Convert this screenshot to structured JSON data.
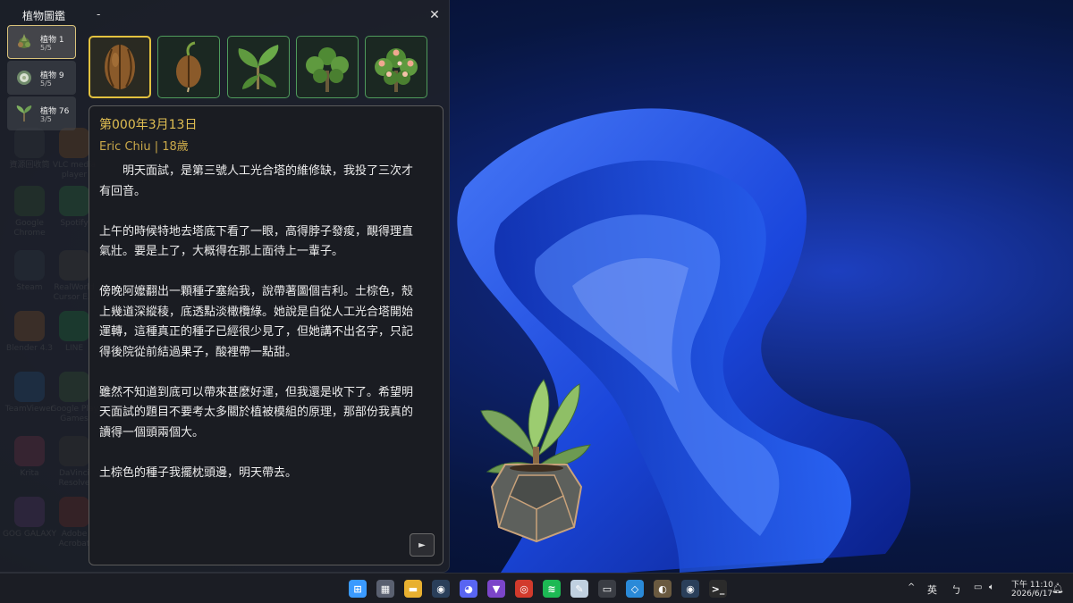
{
  "window": {
    "app_title": "植物圖鑑",
    "sub_title": "-",
    "close_icon": "close-icon"
  },
  "plants": [
    {
      "name": "植物 1",
      "count": "5/5",
      "selected": true
    },
    {
      "name": "植物 9",
      "count": "5/5",
      "selected": false
    },
    {
      "name": "植物 76",
      "count": "3/5",
      "selected": false
    }
  ],
  "stages": [
    {
      "icon": "seed-icon",
      "selected": true
    },
    {
      "icon": "sprout-icon",
      "selected": false
    },
    {
      "icon": "seedling-icon",
      "selected": false
    },
    {
      "icon": "shrub-icon",
      "selected": false
    },
    {
      "icon": "flowering-plant-icon",
      "selected": false
    }
  ],
  "diary": {
    "date": "第000年3月13日",
    "author": "Eric Chiu | 18歲",
    "paragraphs": [
      "明天面試，是第三號人工光合塔的維修缺，我投了三次才有回音。",
      "上午的時候特地去塔底下看了一眼，高得脖子發痠，靦得理直氣壯。要是上了，大概得在那上面待上一輩子。",
      "傍晚阿嬤翻出一顆種子塞給我，說帶著圖個吉利。土棕色，殼上幾道深縱稜，底透點淡橄欖綠。她說是自從人工光合塔開始運轉，這種真正的種子已經很少見了，但她講不出名字，只記得後院從前結過果子，酸裡帶一點甜。",
      "雖然不知道到底可以帶來甚麼好運，但我還是收下了。希望明天面試的題目不要考太多關於植被模組的原理，那部份我真的讀得一個頭兩個大。",
      "土棕色的種子我擺枕頭邊，明天帶去。"
    ],
    "next_label": "►"
  },
  "desktop_icons": [
    {
      "label": "資源回收筒",
      "color": "#3a4a5c"
    },
    {
      "label": "VLC media player",
      "color": "#c86a1a"
    },
    {
      "label": "Google Chrome",
      "color": "#2a7a3a"
    },
    {
      "label": "Spotify",
      "color": "#1db954"
    },
    {
      "label": "Steam",
      "color": "#2a4a6a"
    },
    {
      "label": "RealWorld Cursor E...",
      "color": "#555555"
    },
    {
      "label": "Blender 4.3",
      "color": "#d9762b"
    },
    {
      "label": "LINE",
      "color": "#06c755"
    },
    {
      "label": "TeamViewer",
      "color": "#0e6fd8"
    },
    {
      "label": "Google Play Games",
      "color": "#3a8a4a"
    },
    {
      "label": "Krita",
      "color": "#c0336a"
    },
    {
      "label": "DaVinci Resolve",
      "color": "#444444"
    },
    {
      "label": "GOG GALAXY",
      "color": "#7a3ab0"
    },
    {
      "label": "Adobe Acrobat",
      "color": "#b3261e"
    }
  ],
  "taskbar": {
    "apps": [
      {
        "icon": "windows-start-icon",
        "color": "#3a9aff",
        "glyph": "⊞"
      },
      {
        "icon": "calculator-icon",
        "color": "#5a6070",
        "glyph": "▦"
      },
      {
        "icon": "file-explorer-icon",
        "color": "#e8b030",
        "glyph": "▬"
      },
      {
        "icon": "steam-icon",
        "color": "#2a3f5a",
        "glyph": "◉"
      },
      {
        "icon": "discord-icon",
        "color": "#5865f2",
        "glyph": "◕"
      },
      {
        "icon": "visual-studio-icon",
        "color": "#7b45c9",
        "glyph": "▼"
      },
      {
        "icon": "chrome-icon",
        "color": "#d23a2c",
        "glyph": "◎"
      },
      {
        "icon": "spotify-icon",
        "color": "#1db954",
        "glyph": "≋"
      },
      {
        "icon": "paint-icon",
        "color": "#c0d0e0",
        "glyph": "✎"
      },
      {
        "icon": "game-bar-icon",
        "color": "#3a3d44",
        "glyph": "▭"
      },
      {
        "icon": "vscode-icon",
        "color": "#2a8ad8",
        "glyph": "◇"
      },
      {
        "icon": "gimp-icon",
        "color": "#6a5a40",
        "glyph": "◐"
      },
      {
        "icon": "steam-2-icon",
        "color": "#2a3f5a",
        "glyph": "◉"
      },
      {
        "icon": "terminal-icon",
        "color": "#2b2b2b",
        "glyph": ">_"
      }
    ],
    "tray": {
      "chevron": "^",
      "ime": "英",
      "ime_mode": "ㄅ",
      "time": "下午 11:10",
      "date": "2026/6/17"
    }
  }
}
